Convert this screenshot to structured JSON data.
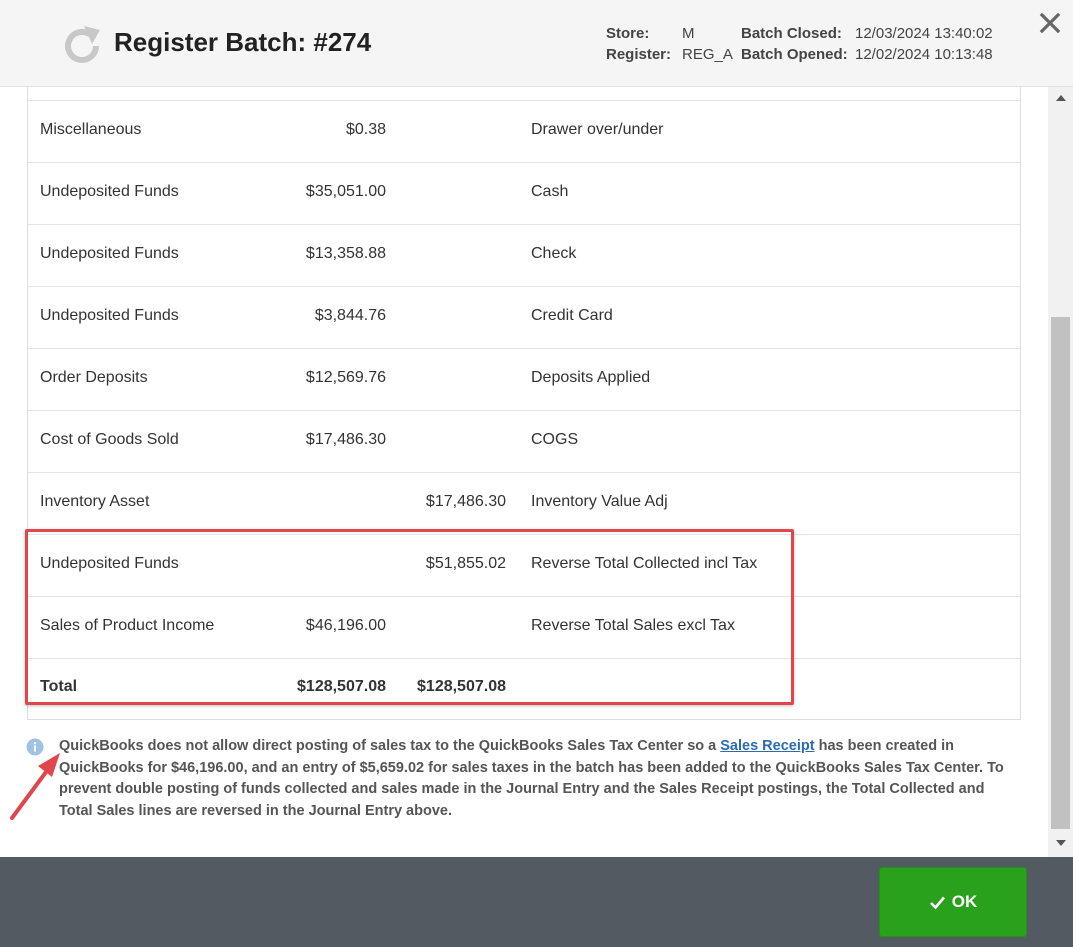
{
  "header": {
    "title": "Register Batch: #274",
    "store_label": "Store:",
    "store_value": "M",
    "register_label": "Register:",
    "register_value": "REG_A",
    "batch_closed_label": "Batch Closed:",
    "batch_closed_value": "12/03/2024 13:40:02",
    "batch_opened_label": "Batch Opened:",
    "batch_opened_value": "12/02/2024 10:13:48"
  },
  "rows": [
    {
      "account": "Miscellaneous",
      "debit": "$0.38",
      "credit": "",
      "memo": "Drawer over/under"
    },
    {
      "account": "Undeposited Funds",
      "debit": "$35,051.00",
      "credit": "",
      "memo": "Cash"
    },
    {
      "account": "Undeposited Funds",
      "debit": "$13,358.88",
      "credit": "",
      "memo": "Check"
    },
    {
      "account": "Undeposited Funds",
      "debit": "$3,844.76",
      "credit": "",
      "memo": "Credit Card"
    },
    {
      "account": "Order Deposits",
      "debit": "$12,569.76",
      "credit": "",
      "memo": "Deposits Applied"
    },
    {
      "account": "Cost of Goods Sold",
      "debit": "$17,486.30",
      "credit": "",
      "memo": "COGS"
    },
    {
      "account": "Inventory Asset",
      "debit": "",
      "credit": "$17,486.30",
      "memo": "Inventory Value Adj"
    },
    {
      "account": "Undeposited Funds",
      "debit": "",
      "credit": "$51,855.02",
      "memo": "Reverse Total Collected incl Tax"
    },
    {
      "account": "Sales of Product Income",
      "debit": "$46,196.00",
      "credit": "",
      "memo": "Reverse Total Sales excl Tax"
    }
  ],
  "total": {
    "label": "Total",
    "debit": "$128,507.08",
    "credit": "$128,507.08"
  },
  "note": {
    "before_link": "QuickBooks does not allow direct posting of sales tax to the QuickBooks Sales Tax Center so a ",
    "link_text": "Sales Receipt",
    "after_link": " has been created in QuickBooks for $46,196.00, and an entry of $5,659.02 for sales taxes in the batch has been added to the QuickBooks Sales Tax Center. To prevent double posting of funds collected and sales made in the Journal Entry and the Sales Receipt postings, the Total Collected and Total Sales lines are reversed in the Journal Entry above."
  },
  "footer": {
    "ok_label": "OK"
  },
  "colors": {
    "ok_green": "#2aa11d",
    "highlight_red": "#e0474c",
    "footer_bg": "#545a62",
    "link_blue": "#2b6cb0"
  },
  "icons": [
    "refresh-icon",
    "close-icon",
    "info-icon",
    "check-icon",
    "annotation-arrow"
  ]
}
